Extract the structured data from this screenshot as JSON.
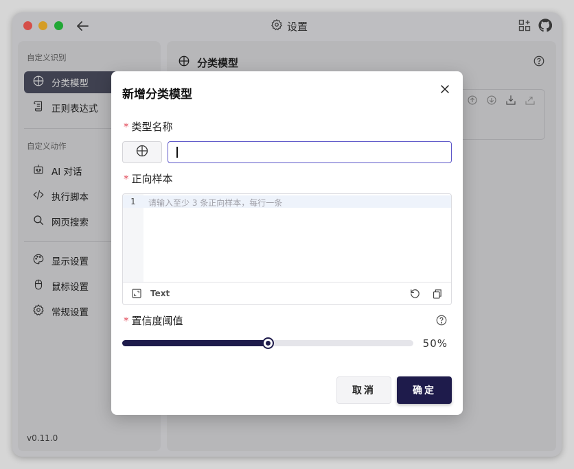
{
  "window": {
    "title": "设置",
    "version": "v0.11.0"
  },
  "sidebar": {
    "groups": [
      {
        "label": "自定义识别",
        "items": [
          {
            "label": "分类模型",
            "icon": "globe-icon",
            "active": true
          },
          {
            "label": "正则表达式",
            "icon": "scroll-icon",
            "active": false
          }
        ]
      },
      {
        "label": "自定义动作",
        "items": [
          {
            "label": "AI 对话",
            "icon": "robot-icon",
            "active": false
          },
          {
            "label": "执行脚本",
            "icon": "code-icon",
            "active": false
          },
          {
            "label": "网页搜索",
            "icon": "search-icon",
            "active": false
          }
        ]
      },
      {
        "label": "",
        "items": [
          {
            "label": "显示设置",
            "icon": "palette-icon",
            "active": false
          },
          {
            "label": "鼠标设置",
            "icon": "mouse-icon",
            "active": false
          },
          {
            "label": "常规设置",
            "icon": "gear-icon",
            "active": false
          }
        ]
      }
    ]
  },
  "main": {
    "header": "分类模型"
  },
  "modal": {
    "title": "新增分类模型",
    "type_name_label": "类型名称",
    "type_name_value": "",
    "samples_label": "正向样本",
    "samples_line_number": "1",
    "samples_placeholder": "请输入至少 3 条正向样本，每行一条",
    "editor_language": "Text",
    "threshold_label": "置信度阈值",
    "threshold_value": 0.5,
    "threshold_display": "50%",
    "cancel_label": "取消",
    "confirm_label": "确定"
  },
  "colors": {
    "accent": "#1e1b4b",
    "required": "#e24a5a",
    "input_focus": "#5b55c8",
    "sidebar_active": "#4c4e60"
  }
}
